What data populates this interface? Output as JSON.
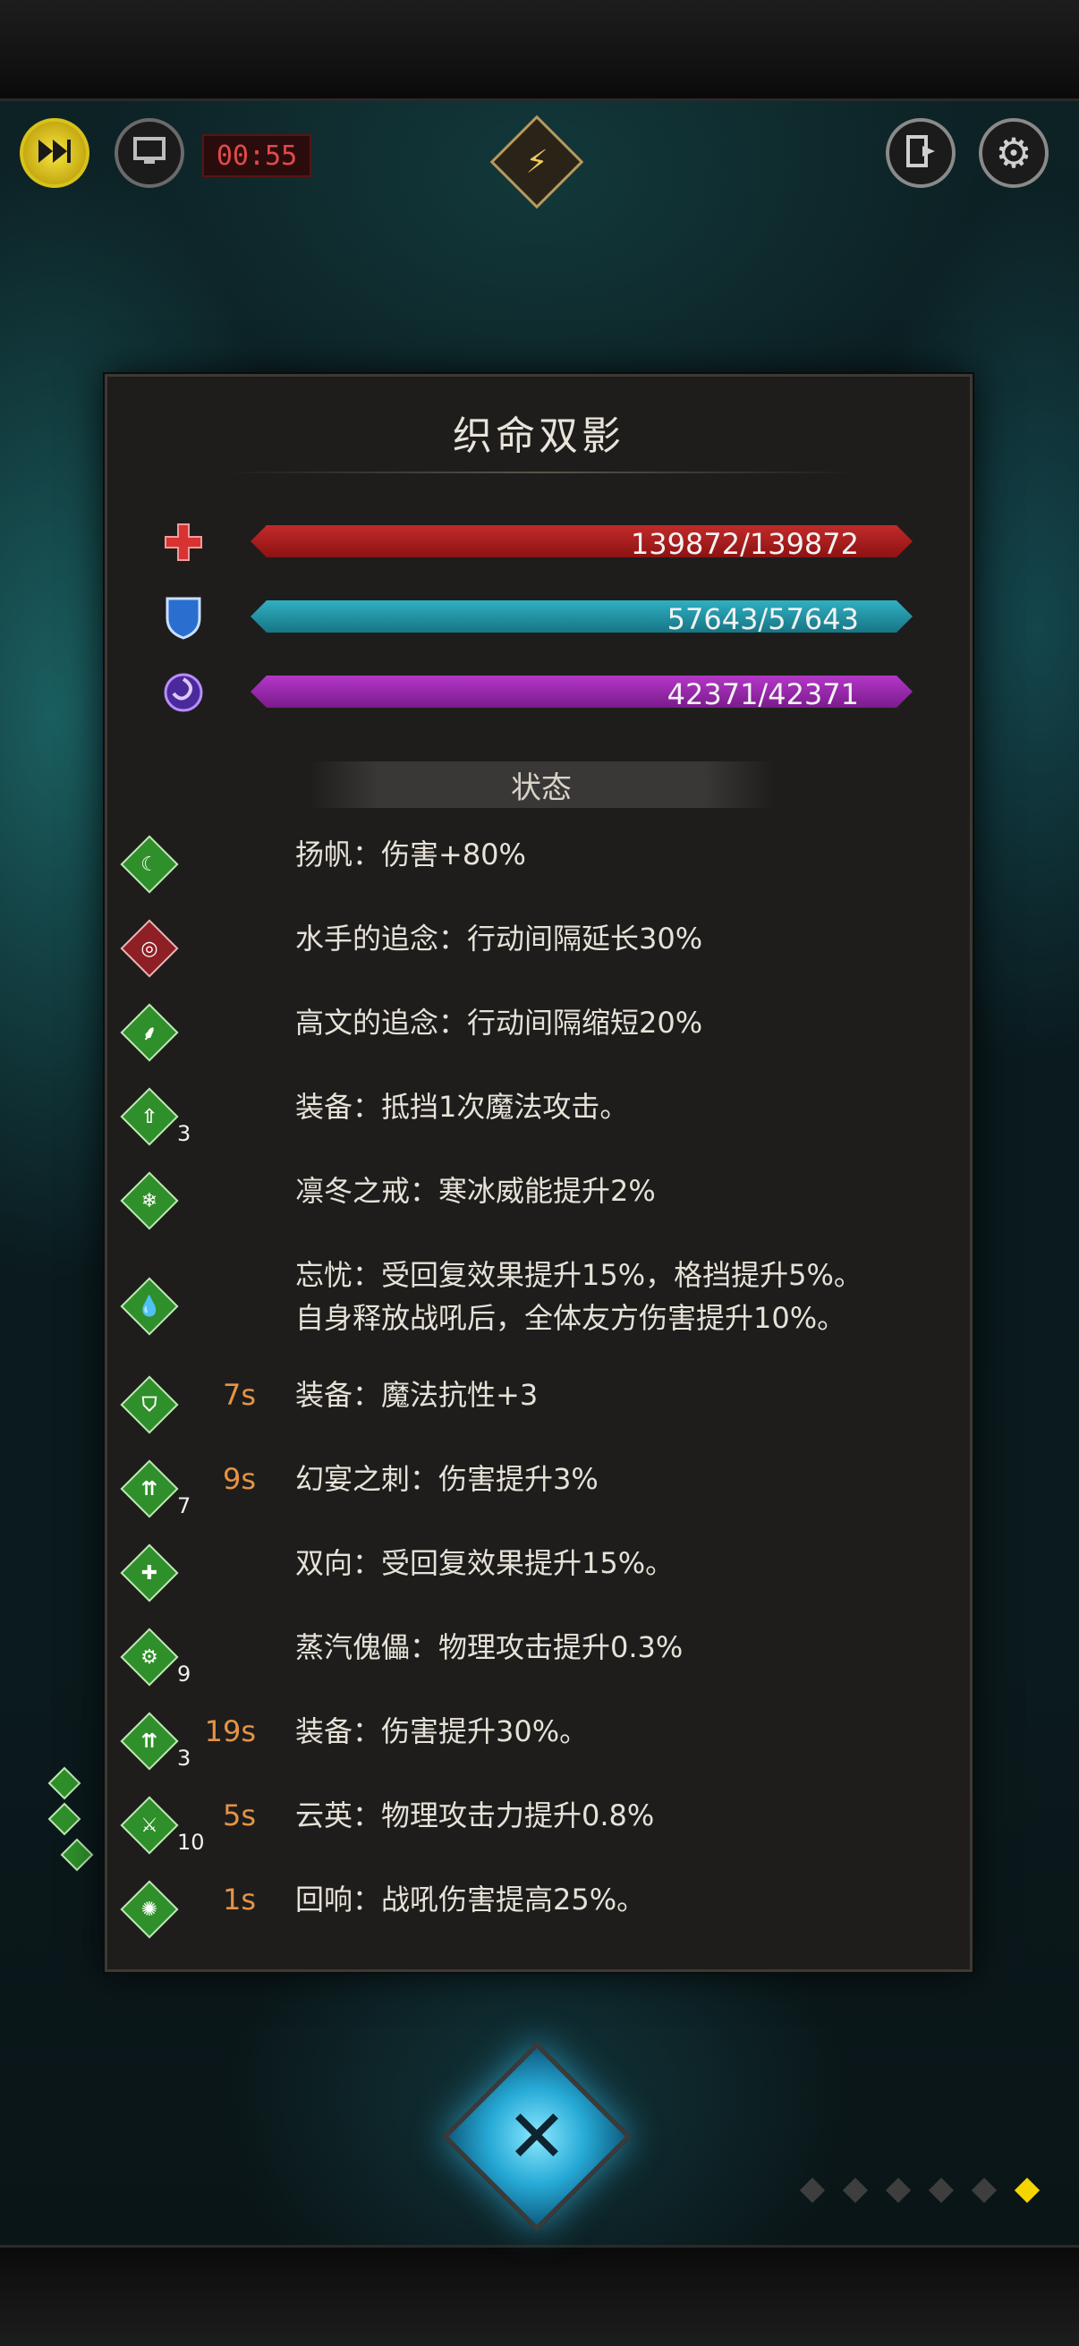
{
  "hud": {
    "timer": "00:55",
    "speed_icon": "fast-forward-icon",
    "auto_icon": "monitor-icon",
    "exit_icon": "exit-door-icon",
    "settings_icon": "gear-icon",
    "center_icon": "lightning-emblem-icon"
  },
  "panel": {
    "title": "织命双影",
    "bars": [
      {
        "icon": "health-cross-icon",
        "text": "139872/139872",
        "color": "#c22a2a",
        "fill": 1.0
      },
      {
        "icon": "shield-icon",
        "text": "57643/57643",
        "color": "#2fb0c2",
        "fill": 1.0
      },
      {
        "icon": "vortex-icon",
        "text": "42371/42371",
        "color": "#b437c8",
        "fill": 1.0
      }
    ],
    "section_label": "状态",
    "statuses": [
      {
        "icon": "crescent-icon",
        "color": "green",
        "stack": "",
        "duration": "",
        "text": "扬帆：伤害+80%"
      },
      {
        "icon": "target-swirl-icon",
        "color": "red",
        "stack": "",
        "duration": "",
        "text": "水手的追念：行动间隔延长30%"
      },
      {
        "icon": "boot-icon",
        "color": "green",
        "stack": "",
        "duration": "",
        "text": "高文的追念：行动间隔缩短20%"
      },
      {
        "icon": "shield-up-icon",
        "color": "green",
        "stack": "3",
        "duration": "",
        "text": "装备：抵挡1次魔法攻击。"
      },
      {
        "icon": "snowflake-icon",
        "color": "green",
        "stack": "",
        "duration": "",
        "text": "凛冬之戒：寒冰威能提升2%"
      },
      {
        "icon": "droplets-icon",
        "color": "green",
        "stack": "",
        "duration": "",
        "text": "忘忧：受回复效果提升15%，格挡提升5%。\n自身释放战吼后，全体友方伤害提升10%。"
      },
      {
        "icon": "shield-icon",
        "color": "green",
        "stack": "",
        "duration": "7s",
        "text": "装备：魔法抗性+3"
      },
      {
        "icon": "arrow-up-icon",
        "color": "green",
        "stack": "7",
        "duration": "9s",
        "text": "幻宴之刺：伤害提升3%"
      },
      {
        "icon": "puzzle-icon",
        "color": "green",
        "stack": "",
        "duration": "",
        "text": "双向：受回复效果提升15%。"
      },
      {
        "icon": "gears-icon",
        "color": "green",
        "stack": "9",
        "duration": "",
        "text": "蒸汽傀儡：物理攻击提升0.3%"
      },
      {
        "icon": "arrow-up-icon",
        "color": "green",
        "stack": "3",
        "duration": "19s",
        "text": "装备：伤害提升30%。"
      },
      {
        "icon": "sword-icon",
        "color": "green",
        "stack": "10",
        "duration": "5s",
        "text": "云英：物理攻击力提升0.8%"
      },
      {
        "icon": "burst-icon",
        "color": "green",
        "stack": "",
        "duration": "1s",
        "text": "回响：战吼伤害提高25%。"
      }
    ]
  },
  "close_icon": "close-x-icon",
  "pagination": {
    "total": 6,
    "active": 6
  }
}
